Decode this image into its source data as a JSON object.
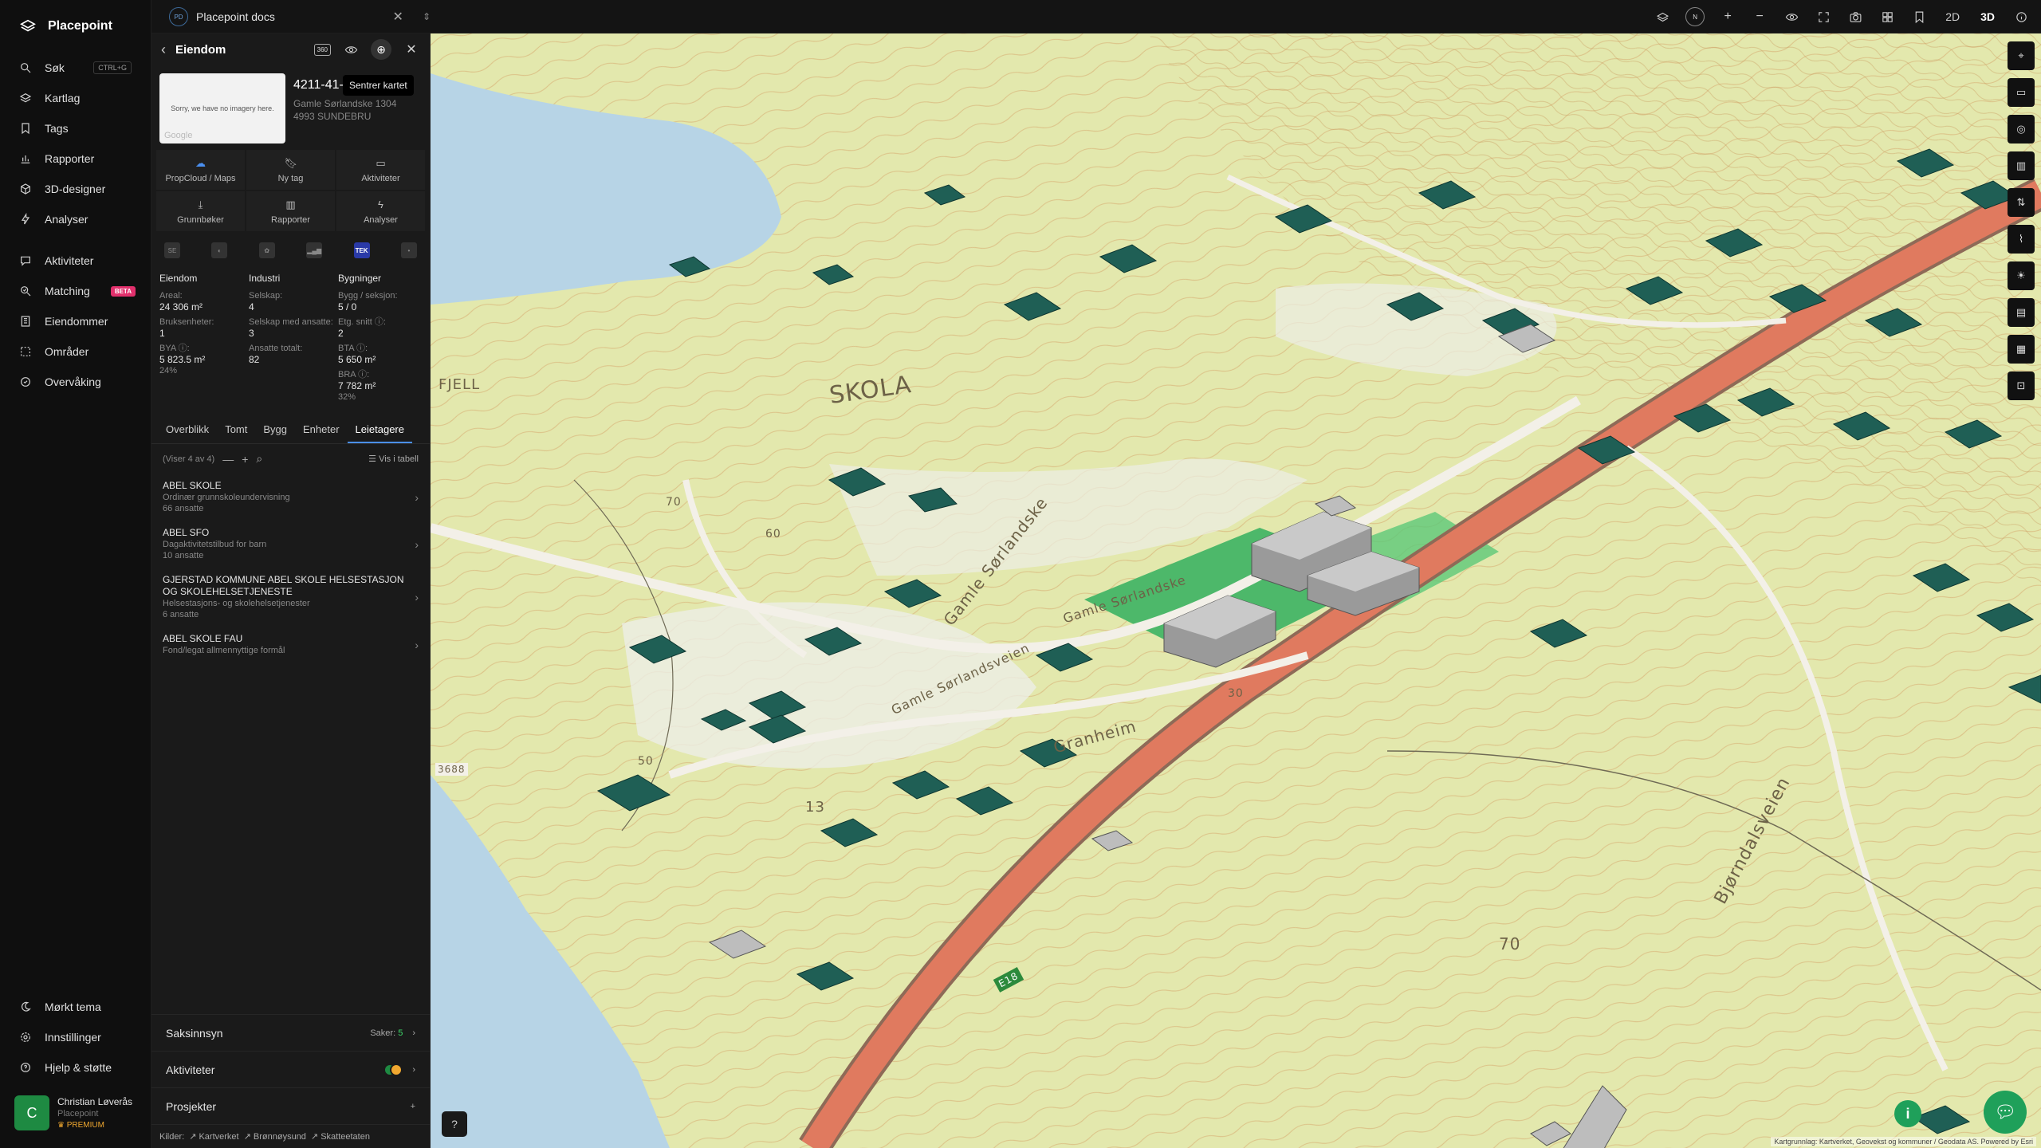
{
  "app": {
    "name": "Placepoint"
  },
  "nav": {
    "items": [
      {
        "label": "Søk",
        "kbd": "CTRL+G"
      },
      {
        "label": "Kartlag"
      },
      {
        "label": "Tags"
      },
      {
        "label": "Rapporter"
      },
      {
        "label": "3D-designer"
      },
      {
        "label": "Analyser"
      },
      {
        "label": "Aktiviteter"
      },
      {
        "label": "Matching",
        "badge": "BETA"
      },
      {
        "label": "Eiendommer"
      },
      {
        "label": "Områder"
      },
      {
        "label": "Overvåking"
      }
    ],
    "bottom": [
      {
        "label": "Mørkt tema"
      },
      {
        "label": "Innstillinger"
      },
      {
        "label": "Hjelp & støtte"
      }
    ],
    "user": {
      "initial": "C",
      "name": "Christian Løverås",
      "org": "Placepoint",
      "plan": "PREMIUM"
    }
  },
  "topbar": {
    "doc_badge": "PD",
    "doc_title": "Placepoint docs",
    "compass": "N",
    "mode_2d": "2D",
    "mode_3d": "3D",
    "active_mode": "3D"
  },
  "panel": {
    "title": "Eiendom",
    "badge360": "360",
    "tooltip": "Sentrer kartet",
    "image_text": "Sorry, we have no imagery here.",
    "image_brand": "Google",
    "property_id": "4211-41-4/0/0",
    "address_line1": "Gamle Sørlandske 1304",
    "address_line2": "4993 SUNDEBRU",
    "actions": [
      {
        "label": "PropCloud / Maps",
        "icon": "cloud-icon"
      },
      {
        "label": "Ny tag",
        "icon": "tag-icon"
      },
      {
        "label": "Aktiviteter",
        "icon": "message-icon"
      },
      {
        "label": "Grunnbøker",
        "icon": "download-icon"
      },
      {
        "label": "Rapporter",
        "icon": "chart-icon"
      },
      {
        "label": "Analyser",
        "icon": "bolt-icon"
      }
    ],
    "layer_badges": [
      "SE",
      "",
      "",
      "",
      "TEK",
      ""
    ],
    "stats": {
      "eiendom": {
        "header": "Eiendom",
        "areal_label": "Areal:",
        "areal_value": "24 306 m²",
        "bruk_label": "Bruksenheter:",
        "bruk_value": "1",
        "bya_label": "BYA ⓘ:",
        "bya_value": "5 823.5 m²",
        "bya_pct": "24%"
      },
      "industri": {
        "header": "Industri",
        "selskap_label": "Selskap:",
        "selskap_value": "4",
        "ansatte_label": "Selskap med ansatte:",
        "ansatte_value": "3",
        "total_label": "Ansatte totalt:",
        "total_value": "82"
      },
      "bygninger": {
        "header": "Bygninger",
        "seksjon_label": "Bygg / seksjon:",
        "seksjon_value": "5 / 0",
        "etg_label": "Etg. snitt ⓘ:",
        "etg_value": "2",
        "bta_label": "BTA ⓘ:",
        "bta_value": "5 650 m²",
        "bra_label": "BRA ⓘ:",
        "bra_value": "7 782 m²",
        "bra_pct": "32%"
      }
    },
    "tabs": [
      "Overblikk",
      "Tomt",
      "Bygg",
      "Enheter",
      "Leietagere"
    ],
    "active_tab": "Leietagere",
    "list_count": "(Viser 4 av 4)",
    "list_table": "Vis i tabell",
    "tenants": [
      {
        "name": "ABEL SKOLE",
        "desc": "Ordinær grunnskoleundervisning",
        "emp": "66 ansatte"
      },
      {
        "name": "ABEL SFO",
        "desc": "Dagaktivitetstilbud for barn",
        "emp": "10 ansatte"
      },
      {
        "name": "GJERSTAD KOMMUNE ABEL SKOLE HELSESTASJON OG SKOLEHELSETJENESTE",
        "desc": "Helsestasjons- og skolehelsetjenester",
        "emp": "6 ansatte"
      },
      {
        "name": "ABEL SKOLE FAU",
        "desc": "Fond/legat allmennyttige formål",
        "emp": ""
      }
    ],
    "sections": {
      "saksinnsyn": "Saksinnsyn",
      "saker_label": "Saker:",
      "saker_value": "5",
      "aktiviteter": "Aktiviteter",
      "prosjekter": "Prosjekter",
      "plus": "+"
    },
    "sources": {
      "label": "Kilder:",
      "items": [
        "Kartverket",
        "Brønnøysund",
        "Skatteetaten"
      ]
    }
  },
  "map": {
    "labels": {
      "mountain": "SKOLA",
      "mountain2": "FJELL",
      "road1": "Gamle Sørlandske",
      "road2": "Gamle Sørlandske",
      "road3": "Granheim",
      "road4": "Bjørndalsveien",
      "road5": "Gamle Sørlandsveien",
      "e18": "E18",
      "n50": "50",
      "n60": "60",
      "n70": "70",
      "n70b": "70",
      "n13": "13",
      "n30": "30",
      "n3688": "3688"
    },
    "attribution": "Kartgrunnlag: Kartverket, Geovekst og kommuner / Geodata AS. Powered by Esri",
    "help": "?",
    "info": "i",
    "colors": {
      "terrain": "#dfe4a6",
      "road": "#e07a5f",
      "water": "#b7d4e6",
      "building": "#1f5f55",
      "field": "#4db86a"
    }
  }
}
